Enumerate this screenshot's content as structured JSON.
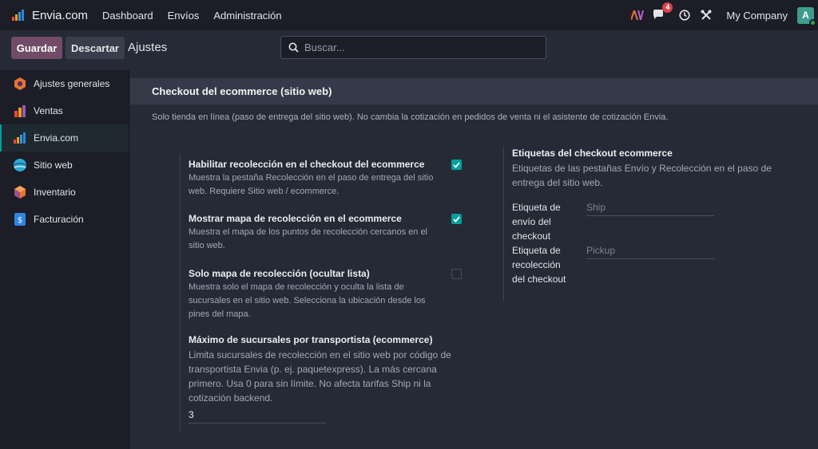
{
  "navbar": {
    "brand": "Envia.com",
    "menu": [
      "Dashboard",
      "Envíos",
      "Administración"
    ],
    "messages_count": "4",
    "company": "My Company",
    "avatar_letter": "A",
    "icons": [
      "envia-logo-icon",
      "ai-icon",
      "chat-icon",
      "clock-icon",
      "tools-icon"
    ]
  },
  "control": {
    "save_label": "Guardar",
    "discard_label": "Descartar",
    "title": "Ajustes",
    "search_placeholder": "Buscar..."
  },
  "sidebar": {
    "items": [
      {
        "label": "Ajustes generales",
        "icon": "general-settings-icon",
        "active": false
      },
      {
        "label": "Ventas",
        "icon": "sales-icon",
        "active": false
      },
      {
        "label": "Envia.com",
        "icon": "envia-icon",
        "active": true
      },
      {
        "label": "Sitio web",
        "icon": "website-icon",
        "active": false
      },
      {
        "label": "Inventario",
        "icon": "inventory-icon",
        "active": false
      },
      {
        "label": "Facturación",
        "icon": "invoicing-icon",
        "active": false
      }
    ]
  },
  "section": {
    "title": "Checkout del ecommerce (sitio web)",
    "description": "Solo tienda en línea (paso de entrega del sitio web). No cambia la cotización en pedidos de venta ni el asistente de cotización Envia."
  },
  "settings": [
    {
      "title": "Habilitar recolección en el checkout del ecommerce",
      "description": "Muestra la pestaña Recolección en el paso de entrega del sitio web. Requiere Sitio web / ecommerce.",
      "checked": true
    },
    {
      "title": "Mostrar mapa de recolección en el ecommerce",
      "description": "Muestra el mapa de los puntos de recolección cercanos en el sitio web.",
      "checked": true
    },
    {
      "title": "Solo mapa de recolección (ocultar lista)",
      "description": "Muestra solo el mapa de recolección y oculta la lista de sucursales en el sitio web. Selecciona la ubicación desde los pines del mapa.",
      "checked": false
    }
  ],
  "max_branches": {
    "title": "Máximo de sucursales por transportista (ecommerce)",
    "description": "Limita sucursales de recolección en el sitio web por código de transportista Envia (p. ej. paquetexpress). La más cercana primero. Usa 0 para sin límite. No afecta tarifas Ship ni la cotización backend.",
    "value": "3"
  },
  "labels_block": {
    "title": "Etiquetas del checkout ecommerce",
    "description": "Etiquetas de las pestañas Envío y Recolección en el paso de entrega del sitio web.",
    "shipping_label": "Etiqueta de envío del checkout",
    "shipping_placeholder": "Ship",
    "pickup_label": "Etiqueta de recolección del checkout",
    "pickup_placeholder": "Pickup"
  },
  "colors": {
    "accent": "#00A09D",
    "primary_button": "#714B67",
    "badge": "#D9434B"
  }
}
